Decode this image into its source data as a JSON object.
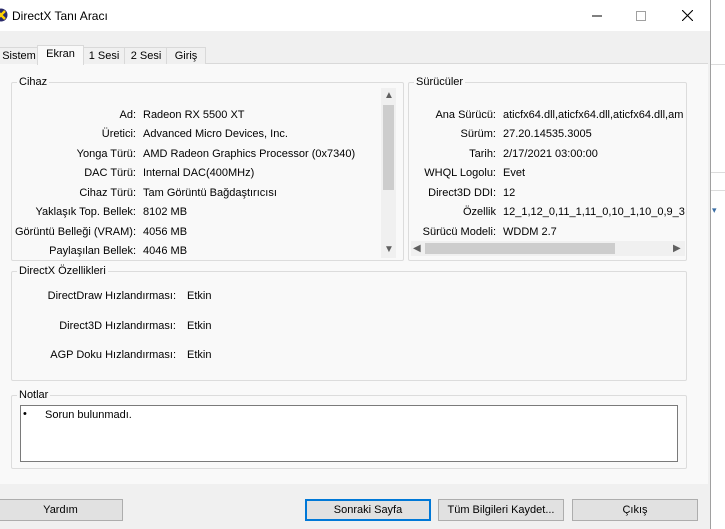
{
  "window": {
    "title": "DirectX Tanı Aracı"
  },
  "tabs": [
    {
      "label": "Sistem"
    },
    {
      "label": "Ekran"
    },
    {
      "label": "1 Sesi"
    },
    {
      "label": "2 Sesi"
    },
    {
      "label": "Giriş"
    }
  ],
  "device": {
    "title": "Cihaz",
    "rows": [
      {
        "label": "Ad:",
        "value": "Radeon RX 5500 XT"
      },
      {
        "label": "Üretici:",
        "value": "Advanced Micro Devices, Inc."
      },
      {
        "label": "Yonga Türü:",
        "value": "AMD Radeon Graphics Processor (0x7340)"
      },
      {
        "label": "DAC Türü:",
        "value": "Internal DAC(400MHz)"
      },
      {
        "label": "Cihaz Türü:",
        "value": "Tam Görüntü Bağdaştırıcısı"
      },
      {
        "label": "Yaklaşık Top. Bellek:",
        "value": "8102 MB"
      },
      {
        "label": "Görüntü Belleği (VRAM):",
        "value": "4056 MB"
      },
      {
        "label": "Paylaşılan Bellek:",
        "value": "4046 MB"
      }
    ]
  },
  "drivers": {
    "title": "Sürücüler",
    "rows": [
      {
        "label": "Ana Sürücü:",
        "value": "aticfx64.dll,aticfx64.dll,aticfx64.dll,am"
      },
      {
        "label": "Sürüm:",
        "value": "27.20.14535.3005"
      },
      {
        "label": "Tarih:",
        "value": "2/17/2021 03:00:00"
      },
      {
        "label": "WHQL Logolu:",
        "value": "Evet"
      },
      {
        "label": "Direct3D DDI:",
        "value": "12"
      },
      {
        "label": "Özellik",
        "value": "12_1,12_0,11_1,11_0,10_1,10_0,9_3"
      },
      {
        "label": "Sürücü Modeli:",
        "value": "WDDM 2.7"
      }
    ]
  },
  "features": {
    "title": "DirectX Özellikleri",
    "rows": [
      {
        "label": "DirectDraw Hızlandırması:",
        "value": "Etkin"
      },
      {
        "label": "Direct3D Hızlandırması:",
        "value": "Etkin"
      },
      {
        "label": "AGP Doku Hızlandırması:",
        "value": "Etkin"
      }
    ]
  },
  "notes": {
    "title": "Notlar",
    "items": [
      "Sorun bulunmadı."
    ]
  },
  "buttons": {
    "help": "Yardım",
    "next_page": "Sonraki Sayfa",
    "save_all": "Tüm Bilgileri Kaydet...",
    "exit": "Çıkış"
  },
  "colors": {
    "window_bg": "#f0f0f0",
    "panel_bg": "#f9f9f9",
    "focus_border": "#0078d7"
  }
}
